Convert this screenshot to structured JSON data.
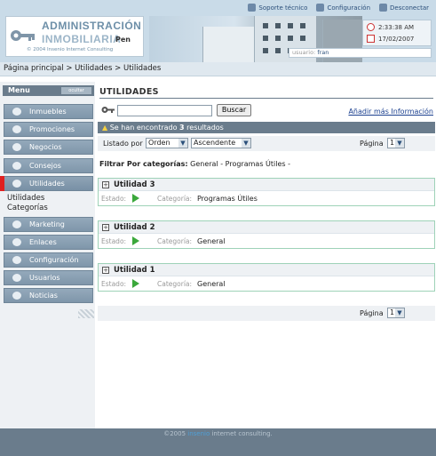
{
  "header": {
    "logo_line1": "ADMINISTRACIÓN",
    "logo_line2": "INMOBILIARIA",
    "logo_sub": "© 2004 Insenio Internet Consulting",
    "logo_pen": "Pen",
    "top_links": [
      {
        "label": "Soporte técnico",
        "icon": "support-icon"
      },
      {
        "label": "Configuración",
        "icon": "config-icon"
      },
      {
        "label": "Desconectar",
        "icon": "logout-icon"
      }
    ],
    "time": "2:33:38 AM",
    "date": "17/02/2007",
    "user_label": "usuario:",
    "user_value": "fran"
  },
  "breadcrumb": "Página principal > Utilidades > Utilidades",
  "sidebar": {
    "title": "Menu",
    "tab": "ocultar",
    "items": [
      {
        "label": "Inmuebles"
      },
      {
        "label": "Promociones"
      },
      {
        "label": "Negocios"
      },
      {
        "label": "Consejos"
      },
      {
        "label": "Utilidades"
      },
      {
        "label": "Marketing"
      },
      {
        "label": "Enlaces"
      },
      {
        "label": "Configuración"
      },
      {
        "label": "Usuarios"
      },
      {
        "label": "Noticias"
      }
    ],
    "subitems": [
      "Utilidades",
      "Categorías"
    ]
  },
  "main": {
    "title": "UTILIDADES",
    "search_value": "",
    "search_button": "Buscar",
    "add_link": "Añadir más Información",
    "results_prefix": "Se han encontrado ",
    "results_count": "3",
    "results_suffix": " resultados",
    "order_label": "Listado por",
    "order_field": "Orden",
    "order_dir": "Ascendente",
    "page_label": "Página",
    "page_value": "1",
    "filter_label": "Filtrar Por categorías:",
    "filter_items": "General - Programas Útiles -",
    "estado_label": "Estado:",
    "categoria_label": "Categoría:",
    "cards": [
      {
        "title": "Utilidad 3",
        "category": "Programas Útiles"
      },
      {
        "title": "Utilidad 2",
        "category": "General"
      },
      {
        "title": "Utilidad 1",
        "category": "General"
      }
    ]
  },
  "footer": {
    "prefix": "©2005 ",
    "brand": "insenio",
    "suffix": " internet consulting."
  }
}
